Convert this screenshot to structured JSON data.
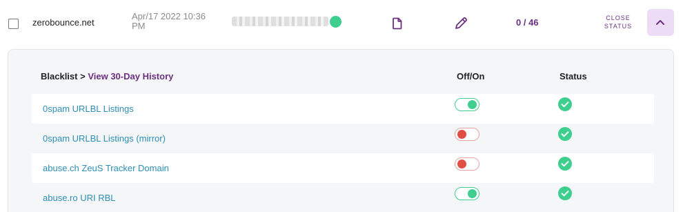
{
  "row": {
    "domain": "zerobounce.net",
    "date": "Apr/17 2022 10:36 PM",
    "count": "0 / 46",
    "close_status_line1": "CLOSE",
    "close_status_line2": "STATUS"
  },
  "colors": {
    "accent_purple": "#6b2f7f",
    "link_blue": "#2d8db5",
    "status_green": "#3ecf8e",
    "status_red": "#e04f43",
    "collapse_bg": "#ecdcf5"
  },
  "panel": {
    "header": {
      "blacklist": "Blacklist",
      "separator": ">",
      "history_link": "View 30-Day History",
      "off_on": "Off/On",
      "status": "Status"
    },
    "blacklists": [
      {
        "name": "0spam URLBL Listings",
        "enabled": true,
        "status": "ok"
      },
      {
        "name": "0spam URLBL Listings (mirror)",
        "enabled": false,
        "status": "ok"
      },
      {
        "name": "abuse.ch ZeuS Tracker Domain",
        "enabled": false,
        "status": "ok"
      },
      {
        "name": "abuse.ro URI RBL",
        "enabled": true,
        "status": "ok"
      }
    ]
  },
  "icons": {
    "online": "status-dot",
    "report": "document-icon",
    "edit": "pencil-icon",
    "collapse": "chevron-up-icon",
    "status_ok": "check-circle-icon"
  }
}
